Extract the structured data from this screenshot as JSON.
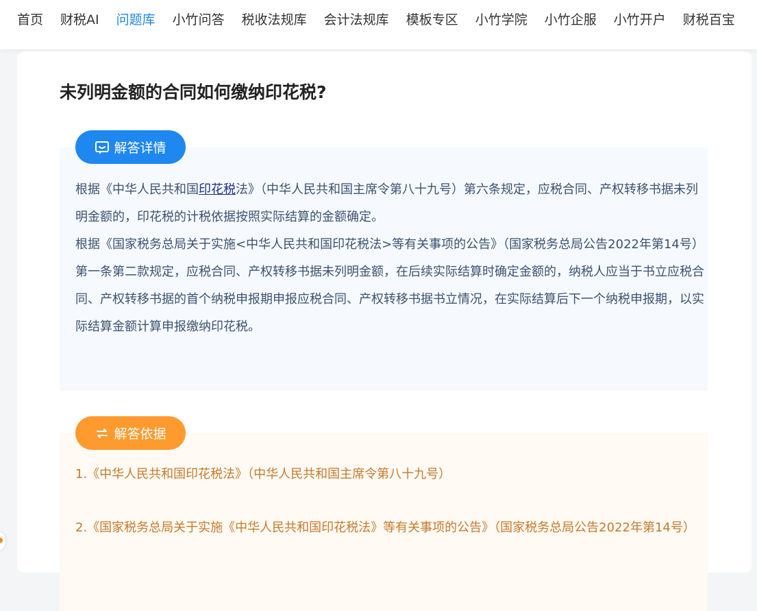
{
  "nav": {
    "items": [
      {
        "label": "首页"
      },
      {
        "label": "财税AI"
      },
      {
        "label": "问题库",
        "active": true
      },
      {
        "label": "小竹问答"
      },
      {
        "label": "税收法规库"
      },
      {
        "label": "会计法规库"
      },
      {
        "label": "模板专区"
      },
      {
        "label": "小竹学院"
      },
      {
        "label": "小竹企服"
      },
      {
        "label": "小竹开户"
      },
      {
        "label": "财税百宝"
      }
    ],
    "active_color": "#1e88e5"
  },
  "question": {
    "title": "未列明金额的合同如何缴纳印花税?"
  },
  "answer_section": {
    "badge_label": "解答详情",
    "badge_icon": "chat-bubble-icon",
    "color": "#1e88f0",
    "paragraph1_prefix": "根据《中华人民共和国",
    "paragraph1_link": "印花税",
    "paragraph1_suffix": "法》（中华人民共和国主席令第八十九号）第六条规定，应税合同、产权转移书据未列明金额的，印花税的计税依据按照实际结算的金额确定。",
    "paragraph2": "根据《国家税务总局关于实施<中华人民共和国印花税法>等有关事项的公告》（国家税务总局公告2022年第14号）第一条第二款规定，应税合同、产权转移书据未列明金额，在后续实际结算时确定金额的，纳税人应当于书立应税合同、产权转移书据的首个纳税申报期申报应税合同、产权转移书据书立情况，在实际结算后下一个纳税申报期，以实际结算金额计算申报缴纳印花税。"
  },
  "basis_section": {
    "badge_label": "解答依据",
    "badge_icon": "exchange-icon",
    "color": "#ff9a2e",
    "items": [
      "1.《中华人民共和国印花税法》（中华人民共和国主席令第八十九号）",
      "2.《国家税务总局关于实施《中华人民共和国印花税法》等有关事项的公告》（国家税务总局公告2022年第14号）"
    ]
  }
}
